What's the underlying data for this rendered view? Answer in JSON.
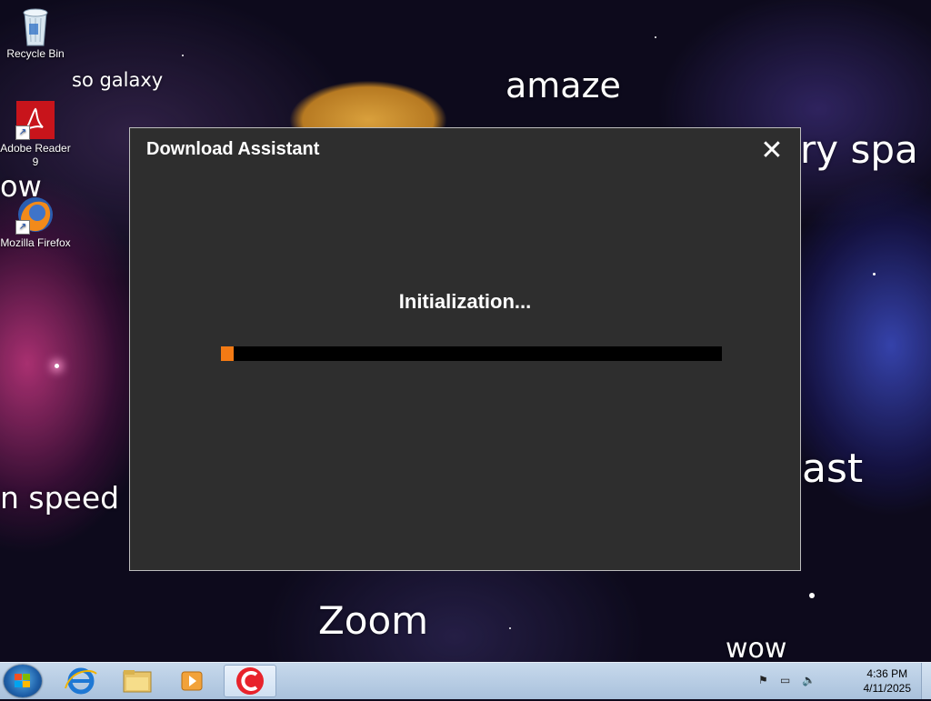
{
  "desktop": {
    "icons": [
      {
        "label": "Recycle Bin",
        "icon": "recycle-bin-icon"
      },
      {
        "label": "Adobe Reader 9",
        "icon": "adobe-reader-icon"
      },
      {
        "label": "Mozilla Firefox",
        "icon": "firefox-icon"
      }
    ],
    "wallpaper_texts": {
      "so_galaxy": "so galaxy",
      "amaze": "amaze",
      "ry_spa": "ry spa",
      "ow": "ow",
      "n_speed": "n speed",
      "ast": "ast",
      "zoom": "Zoom",
      "wow": "wow"
    }
  },
  "dialog": {
    "title": "Download Assistant",
    "close_icon": "close-icon",
    "status": "Initialization...",
    "progress_fraction": 0.025,
    "progress_color": "#f37a14"
  },
  "taskbar": {
    "start_icon": "windows-start-icon",
    "pinned": [
      {
        "icon": "internet-explorer-icon"
      },
      {
        "icon": "file-explorer-icon"
      },
      {
        "icon": "media-player-icon"
      },
      {
        "icon": "download-assistant-app-icon",
        "active": true
      }
    ],
    "tray_icons": [
      "action-center-icon",
      "network-icon",
      "volume-muted-icon"
    ],
    "clock": {
      "time": "4:36 PM",
      "date": "4/11/2025"
    }
  }
}
